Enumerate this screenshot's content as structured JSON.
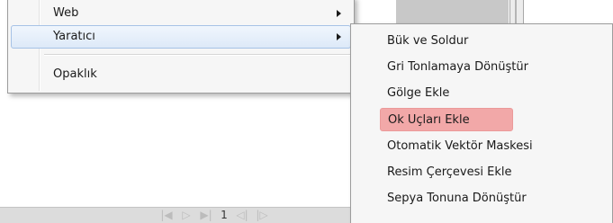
{
  "primary_menu": {
    "items": [
      {
        "label": "Web",
        "has_submenu": true,
        "active": false
      },
      {
        "label": "Yaratıcı",
        "has_submenu": true,
        "active": true
      },
      {
        "label": "Opaklık",
        "has_submenu": false,
        "active": false
      }
    ]
  },
  "submenu": {
    "items": [
      {
        "label": "Bük ve Soldur"
      },
      {
        "label": "Gri Tonlamaya Dönüştür"
      },
      {
        "label": "Gölge Ekle"
      },
      {
        "label": "Ok Uçları Ekle",
        "highlighted": true
      },
      {
        "label": "Otomatik Vektör Maskesi"
      },
      {
        "label": "Resim Çerçevesi Ekle"
      },
      {
        "label": "Sepya Tonuna Dönüştür"
      }
    ],
    "highlight_color": "#f2a8a8"
  },
  "page_nav": {
    "current_page": "1",
    "first_icon": "first-page-icon",
    "prev_icon": "prev-page-icon",
    "next_icon": "next-page-icon",
    "last_icon": "last-page-icon"
  },
  "colors": {
    "menu_active": "#dde9f8",
    "menu_background": "#f6f6f6"
  }
}
